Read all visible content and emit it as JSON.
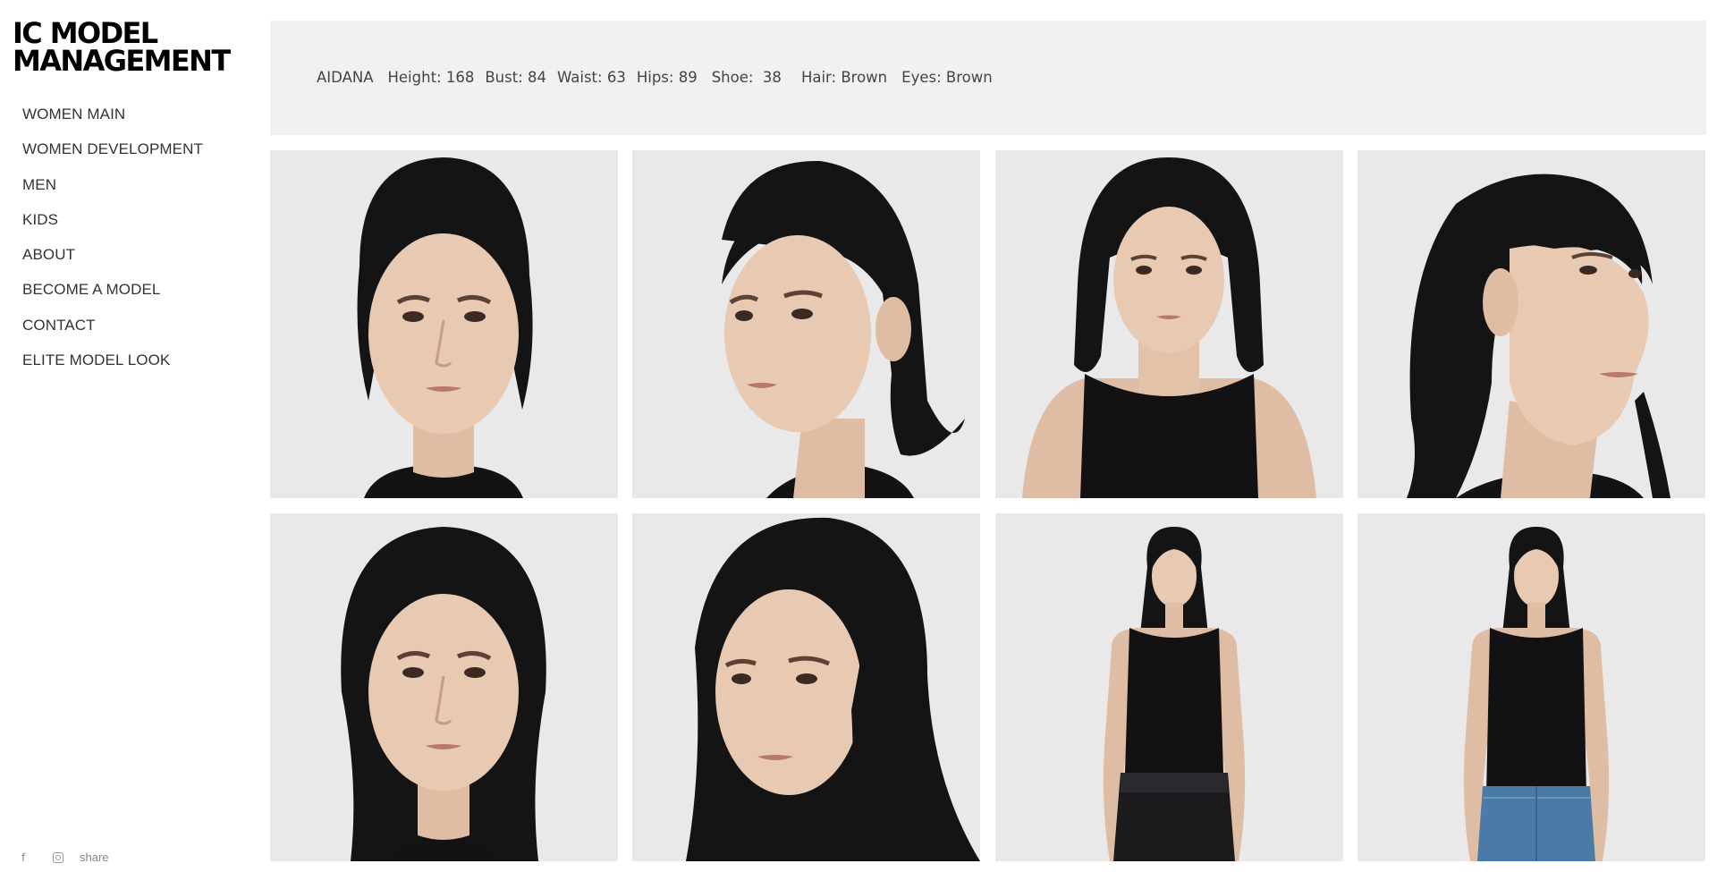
{
  "brand": {
    "line1": "IC MODEL",
    "line2": "MANAGEMENT"
  },
  "nav": {
    "items": [
      {
        "label": "WOMEN MAIN"
      },
      {
        "label": "WOMEN DEVELOPMENT"
      },
      {
        "label": "MEN"
      },
      {
        "label": "KIDS"
      },
      {
        "label": "ABOUT"
      },
      {
        "label": "BECOME A MODEL"
      },
      {
        "label": "CONTACT"
      },
      {
        "label": "ELITE MODEL LOOK"
      }
    ]
  },
  "footer": {
    "facebook_icon": "facebook-icon",
    "instagram_icon": "instagram-icon",
    "share_label": "share"
  },
  "model": {
    "name": "AIDANA",
    "height": "Height: 168",
    "bust": "Bust: 84",
    "waist": "Waist: 63",
    "hips": "Hips: 89",
    "shoe": "Shoe:  38",
    "hair": "Hair: Brown",
    "eyes": "Eyes: Brown"
  },
  "gallery": {
    "photos": [
      {
        "view": "front-headshot"
      },
      {
        "view": "three-quarter-left-headshot"
      },
      {
        "view": "front-bust"
      },
      {
        "view": "profile-right-headshot"
      },
      {
        "view": "front-headshot-hair-down"
      },
      {
        "view": "three-quarter-headshot-hair-down"
      },
      {
        "view": "full-body-front-black-skirt"
      },
      {
        "view": "full-body-front-denim"
      }
    ]
  },
  "colors": {
    "photo_bg": "#e8e8e8",
    "infobar_bg": "#f1f1f1",
    "hair": "#141414",
    "skin": "#e7c8b0",
    "top": "#121214",
    "denim": "#4a7aa6"
  }
}
